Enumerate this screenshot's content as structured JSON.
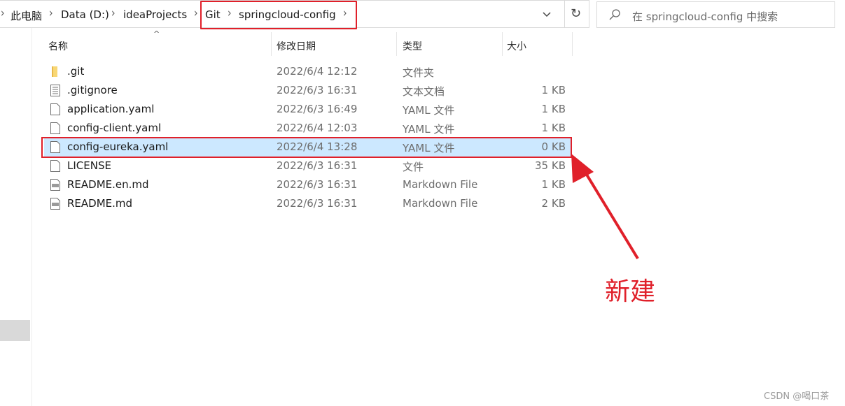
{
  "breadcrumb": {
    "items": [
      "此电脑",
      "Data (D:)",
      "ideaProjects",
      "Git",
      "springcloud-config"
    ]
  },
  "search": {
    "placeholder": "在 springcloud-config 中搜索"
  },
  "columns": {
    "name": "名称",
    "date": "修改日期",
    "type": "类型",
    "size": "大小"
  },
  "files": [
    {
      "name": ".git",
      "date": "2022/6/4 12:12",
      "type": "文件夹",
      "size": "",
      "icon": "folder-icon"
    },
    {
      "name": ".gitignore",
      "date": "2022/6/3 16:31",
      "type": "文本文档",
      "size": "1 KB",
      "icon": "text-file-icon"
    },
    {
      "name": "application.yaml",
      "date": "2022/6/3 16:49",
      "type": "YAML 文件",
      "size": "1 KB",
      "icon": "file-icon"
    },
    {
      "name": "config-client.yaml",
      "date": "2022/6/4 12:03",
      "type": "YAML 文件",
      "size": "1 KB",
      "icon": "file-icon"
    },
    {
      "name": "config-eureka.yaml",
      "date": "2022/6/4 13:28",
      "type": "YAML 文件",
      "size": "0 KB",
      "icon": "file-icon",
      "selected": true
    },
    {
      "name": "LICENSE",
      "date": "2022/6/3 16:31",
      "type": "文件",
      "size": "35 KB",
      "icon": "file-icon"
    },
    {
      "name": "README.en.md",
      "date": "2022/6/3 16:31",
      "type": "Markdown File",
      "size": "1 KB",
      "icon": "markdown-file-icon"
    },
    {
      "name": "README.md",
      "date": "2022/6/3 16:31",
      "type": "Markdown File",
      "size": "2 KB",
      "icon": "markdown-file-icon"
    }
  ],
  "annotation": {
    "label": "新建",
    "color": "#e0202a"
  },
  "watermark": "CSDN @喝口茶",
  "colors": {
    "selection": "#cce8ff",
    "highlight": "#e0202a"
  }
}
